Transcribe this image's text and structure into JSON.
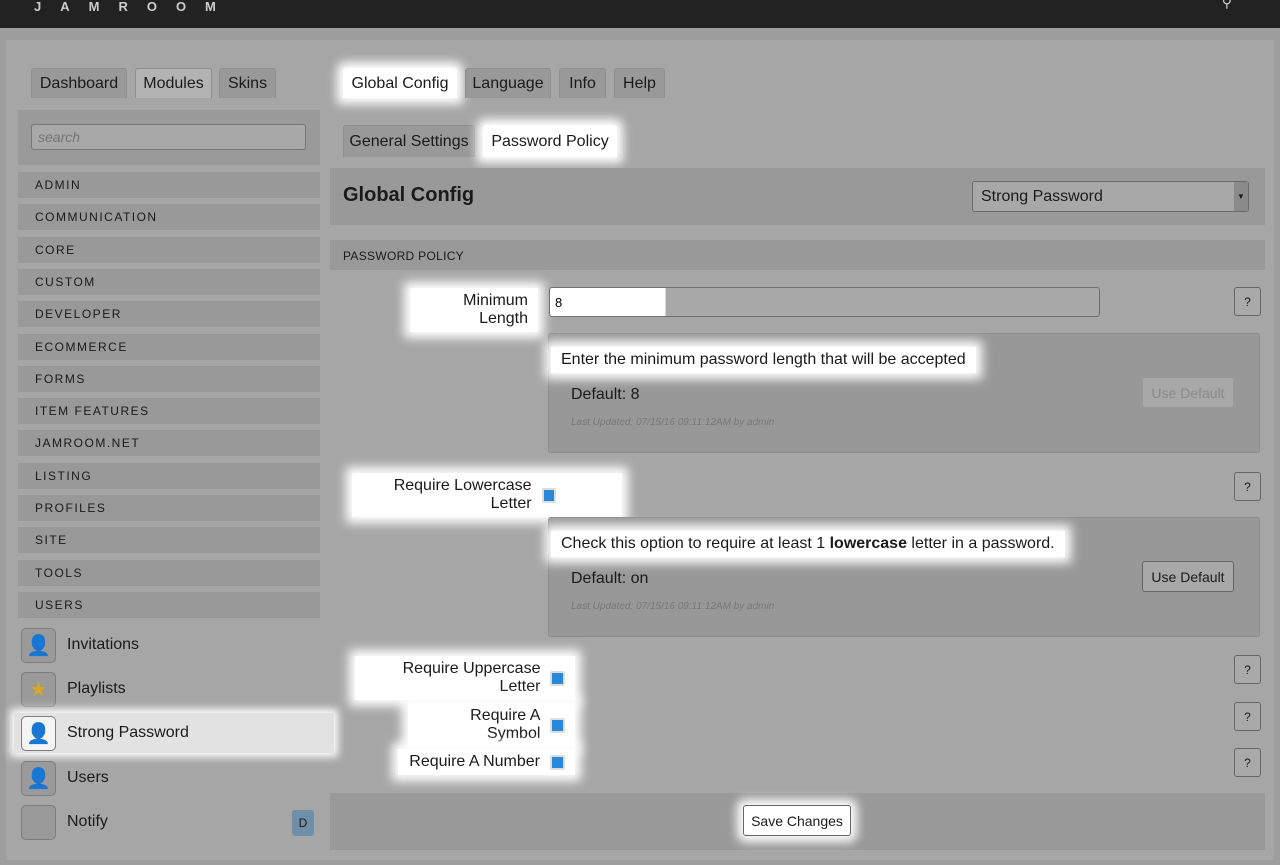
{
  "header": {
    "logo": "JAMROOM",
    "search_icon": "magnifier"
  },
  "left_tabs": [
    "Dashboard",
    "Modules",
    "Skins"
  ],
  "search": {
    "placeholder": "search",
    "value": ""
  },
  "categories": [
    "ADMIN",
    "COMMUNICATION",
    "CORE",
    "CUSTOM",
    "DEVELOPER",
    "ECOMMERCE",
    "FORMS",
    "ITEM FEATURES",
    "JAMROOM.NET",
    "LISTING",
    "PROFILES",
    "SITE",
    "TOOLS",
    "USERS"
  ],
  "modules": [
    {
      "label": "Invitations",
      "icon": "user-arrow-icon"
    },
    {
      "label": "Playlists",
      "icon": "notepad-star-icon"
    },
    {
      "label": "Strong Password",
      "icon": "user-lock-icon"
    },
    {
      "label": "Users",
      "icon": "user-icon"
    },
    {
      "label": "Notify",
      "icon": "blank-icon",
      "badge": "D"
    }
  ],
  "main_tabs": [
    "Global Config",
    "Language",
    "Info",
    "Help"
  ],
  "sub_tabs": [
    "General Settings",
    "Password Policy"
  ],
  "config": {
    "title": "Global Config",
    "selected_module": "Strong Password",
    "section": "PASSWORD POLICY"
  },
  "fields": {
    "min_length": {
      "label": "Minimum Length",
      "value": "8",
      "help": "Enter the minimum password length that will be accepted",
      "default": "Default: 8",
      "updated": "Last Updated: 07/15/16 09:11:12AM by admin",
      "use_default": "Use Default"
    },
    "lowercase": {
      "label": "Require Lowercase Letter",
      "checked": true,
      "help_pre": "Check this option to require at least 1 ",
      "help_bold": "lowercase",
      "help_post": " letter in a password.",
      "default": "Default: on",
      "updated": "Last Updated: 07/15/16 09:11:12AM by admin",
      "use_default": "Use Default"
    },
    "uppercase": {
      "label": "Require Uppercase Letter",
      "checked": true
    },
    "symbol": {
      "label": "Require A Symbol",
      "checked": true
    },
    "number": {
      "label": "Require A Number",
      "checked": true
    }
  },
  "help_button": "?",
  "save_label": "Save Changes"
}
